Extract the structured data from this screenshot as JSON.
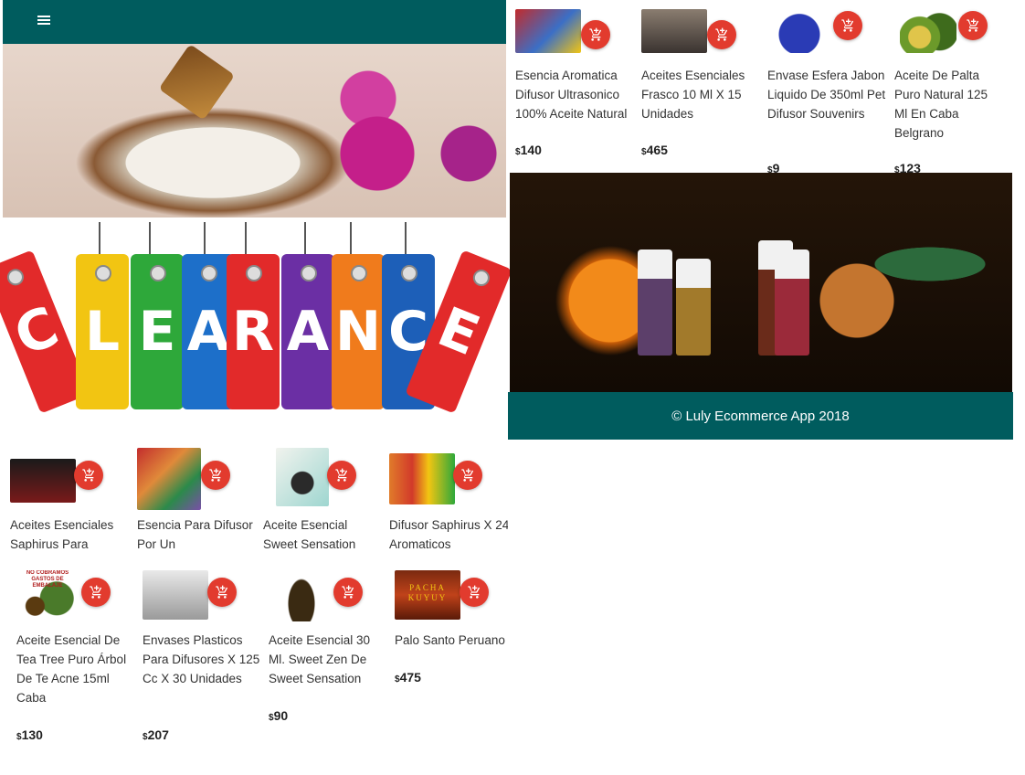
{
  "colors": {
    "nav": "#005c5e",
    "cart_button": "#e23b2e"
  },
  "nav": {
    "menu_icon": "hamburger-icon"
  },
  "banner": {
    "text": "CLEARANCE",
    "letters": [
      "C",
      "L",
      "E",
      "A",
      "R",
      "A",
      "N",
      "C",
      "E"
    ]
  },
  "footer": {
    "text": "© Luly Ecommerce App 2018"
  },
  "top_products": [
    {
      "title": "Esencia Aromatica Difusor Ultrasonico 100% Aceite Natural",
      "currency": "$",
      "price": "140"
    },
    {
      "title": "Aceites Esenciales Frasco 10 Ml X 15 Unidades",
      "currency": "$",
      "price": "465"
    },
    {
      "title": "Envase Esfera Jabon Liquido De 350ml Pet Difusor Souvenirs",
      "currency": "$",
      "price": "9"
    },
    {
      "title": "Aceite De Palta Puro Natural 125 Ml En Caba Belgrano",
      "currency": "$",
      "price": "123"
    }
  ],
  "middle_products": [
    {
      "title": "Aceites Esenciales Saphirus Para"
    },
    {
      "title": "Esencia Para Difusor Por Un"
    },
    {
      "title": "Aceite Esencial Sweet Sensation"
    },
    {
      "title": "Difusor Saphirus X 24 Aromaticos"
    }
  ],
  "bottom_products": [
    {
      "title": "Aceite Esencial De Tea Tree Puro Árbol De Te Acne 15ml Caba",
      "currency": "$",
      "price": "130",
      "badge": "NO COBRAMOS GASTOS DE EMBALAJE"
    },
    {
      "title": "Envases Plasticos Para Difusores X 125 Cc X 30 Unidades",
      "currency": "$",
      "price": "207"
    },
    {
      "title": "Aceite Esencial 30 Ml. Sweet Zen De Sweet Sensation",
      "currency": "$",
      "price": "90"
    },
    {
      "title": "Palo Santo Peruano",
      "currency": "$",
      "price": "475",
      "badge": "PACHA KUYUY"
    }
  ]
}
